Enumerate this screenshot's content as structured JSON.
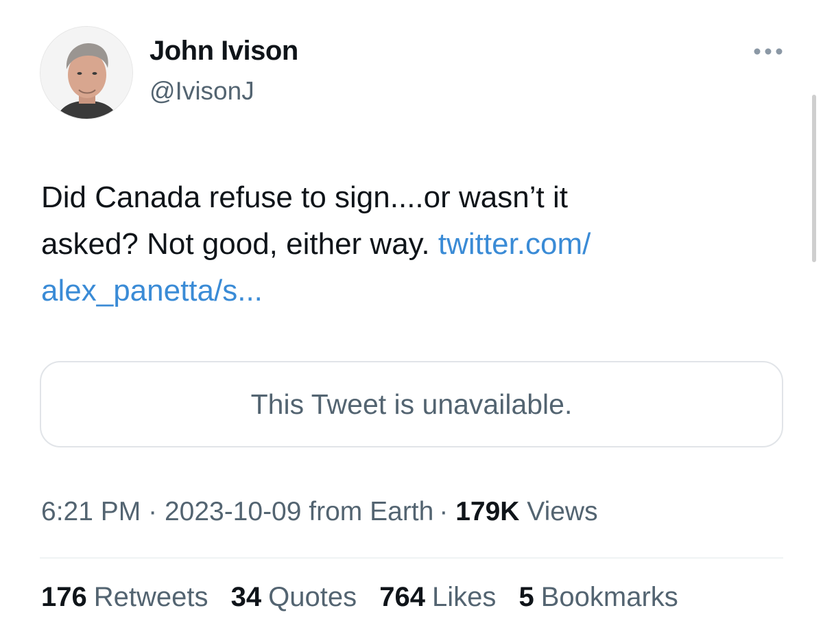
{
  "author": {
    "name": "John Ivison",
    "handle": "@IvisonJ"
  },
  "tweet": {
    "text_line1": "Did Canada refuse to sign....or wasn’t it",
    "text_line2_plain": "asked? Not good, either way.",
    "link_part1": "twitter.com/",
    "link_part2": "alex_panetta/s..."
  },
  "quote": {
    "unavailable_text": "This Tweet is unavailable."
  },
  "meta": {
    "time": "6:21 PM",
    "separator": "·",
    "date": "2023-10-09",
    "source": "from Earth",
    "views_count": "179K",
    "views_label": "Views"
  },
  "stats": {
    "retweets_count": "176",
    "retweets_label": "Retweets",
    "quotes_count": "34",
    "quotes_label": "Quotes",
    "likes_count": "764",
    "likes_label": "Likes",
    "bookmarks_count": "5",
    "bookmarks_label": "Bookmarks"
  },
  "colors": {
    "text_primary": "#0f1419",
    "text_secondary": "#536471",
    "link": "#3a8bd6",
    "border": "#e1e4e8"
  },
  "icons": {
    "more": "more-horizontal-icon"
  }
}
